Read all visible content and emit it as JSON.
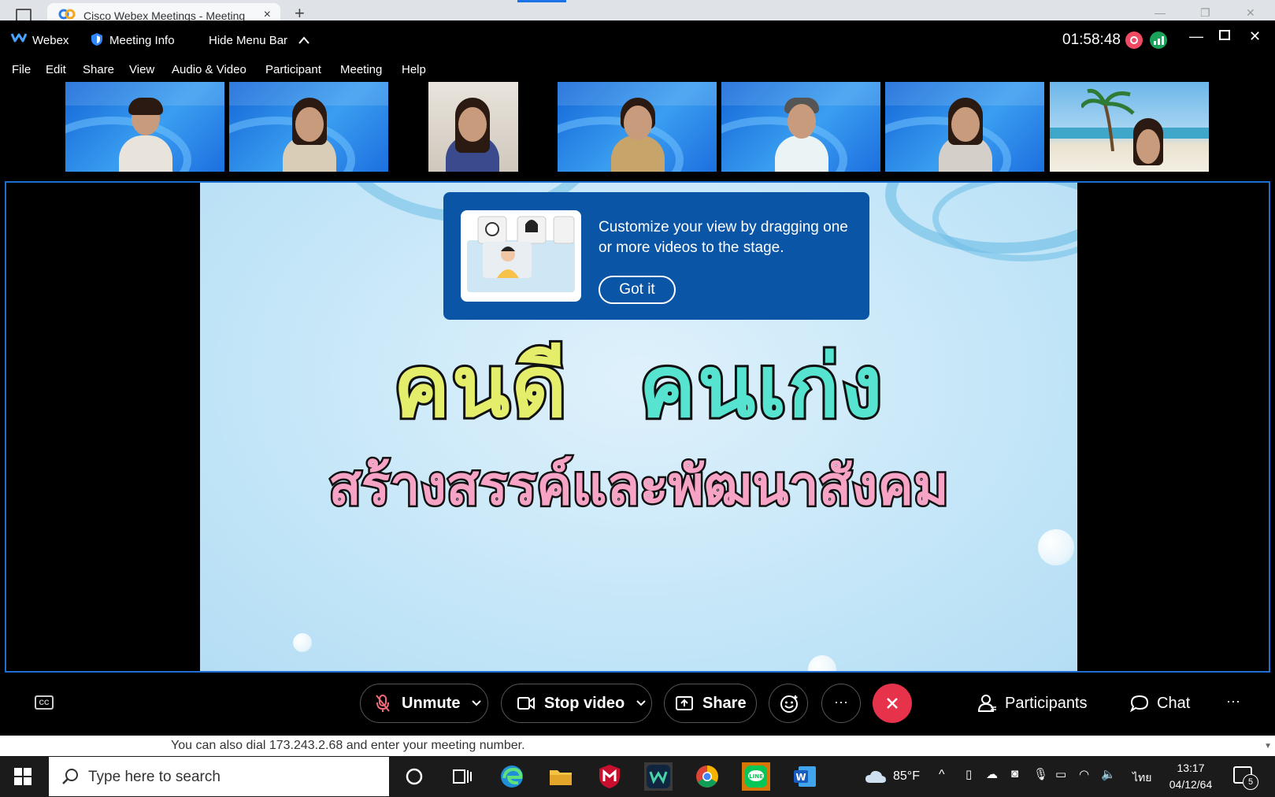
{
  "browser": {
    "tab_title": "Cisco Webex Meetings - Meeting",
    "tab_close": "×",
    "new_tab": "+"
  },
  "titlebar": {
    "app_name": "Webex",
    "meeting_info": "Meeting Info",
    "hide_menu": "Hide Menu Bar",
    "timer": "01:58:48"
  },
  "menu": [
    "File",
    "Edit",
    "Share",
    "View",
    "Audio & Video",
    "Participant",
    "Meeting",
    "Help"
  ],
  "slide": {
    "word1": "คนดี",
    "word2": "คนเก่ง",
    "line2": "สร้างสรรค์และพัฒนาสังคม"
  },
  "tooltip": {
    "text": "Customize your view by dragging one or more videos to the stage.",
    "button": "Got it"
  },
  "controls": {
    "cc": "CC",
    "unmute": "Unmute",
    "stop_video": "Stop video",
    "share": "Share",
    "more": "···",
    "participants": "Participants",
    "chat": "Chat",
    "overflow": "···"
  },
  "dial_text": "You can also dial 173.243.2.68 and enter your meeting number.",
  "taskbar": {
    "search_placeholder": "Type here to search",
    "weather": "85°F",
    "language": "ไทย",
    "time": "13:17",
    "date": "04/12/64",
    "notification_count": "5"
  },
  "colors": {
    "accent": "#1f6fd1",
    "tooltip_bg": "#0b55a6",
    "end_call": "#e6334b",
    "record": "#f04a64",
    "network": "#1aa25a"
  }
}
